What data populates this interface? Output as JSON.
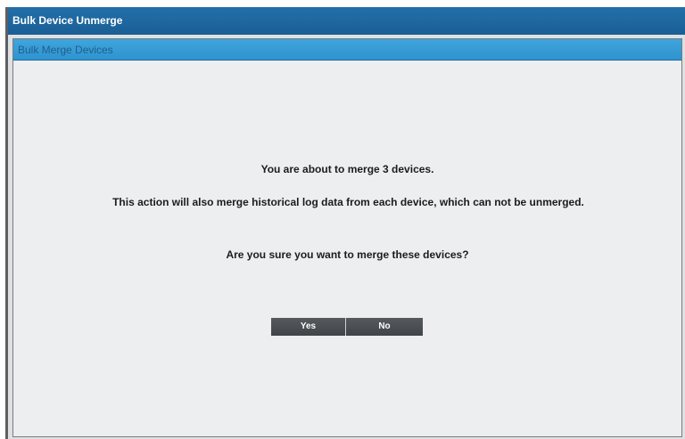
{
  "window": {
    "title": "Bulk Device Unmerge"
  },
  "panel": {
    "header": "Bulk Merge Devices"
  },
  "dialog": {
    "message_count": "You are about to merge 3 devices.",
    "message_warning": "This action will also merge historical log data from each device, which can not be unmerged.",
    "message_confirm": "Are you sure you want to merge these devices?"
  },
  "buttons": {
    "yes_label": "Yes",
    "no_label": "No"
  },
  "colors": {
    "title_bar": "#1a5f96",
    "panel_header": "#3fa5dc",
    "button": "#4a4d50"
  }
}
